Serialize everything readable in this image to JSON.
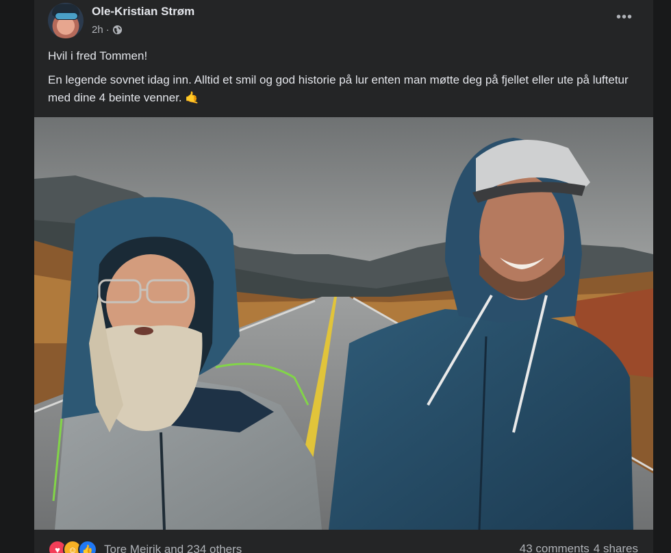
{
  "post": {
    "author": "Ole-Kristian Strøm",
    "time": "2h",
    "separator": "·",
    "privacy_icon": "globe-icon",
    "more_icon": "more-options-icon",
    "more_label": "•••",
    "title_line": "Hvil i fred Tommen!",
    "body": "En legende sovnet idag inn. Alltid et smil og god historie på lur enten man møtte deg på fjellet eller ute på luftetur med dine 4 beinte venner. 🤙"
  },
  "footer": {
    "reactions": [
      {
        "type": "love",
        "glyph": "♥"
      },
      {
        "type": "care",
        "glyph": "☺"
      },
      {
        "type": "like",
        "glyph": "👍"
      }
    ],
    "reaction_text": "Tore Meirik and 234 others",
    "comments": "43 comments",
    "shares": "4 shares"
  },
  "colors": {
    "page_bg": "#18191a",
    "card_bg": "#242526",
    "text_primary": "#e4e6eb",
    "text_secondary": "#b0b3b8",
    "love": "#f33e58",
    "care": "#f7b125",
    "like": "#2078f4"
  }
}
